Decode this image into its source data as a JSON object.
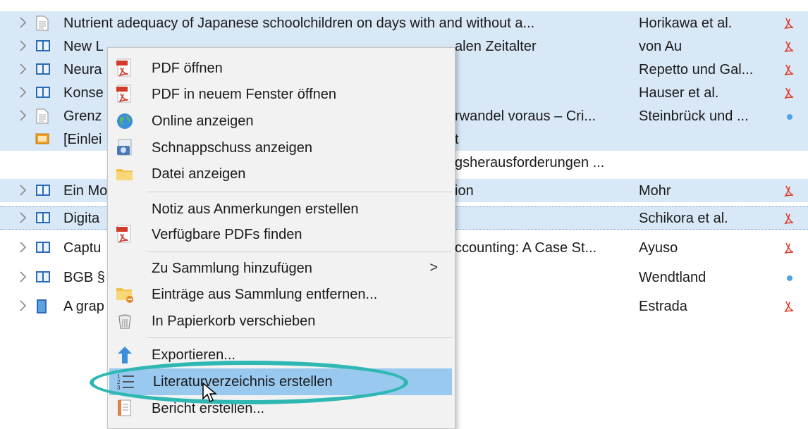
{
  "items": [
    {
      "title": "Nutrient adequacy of Japanese schoolchildren on days with and without a...",
      "creator": "Horikawa et al.",
      "type_icon": "document-icon",
      "attachment": "pdf-icon",
      "selected": true,
      "twisty": true
    },
    {
      "title": "New L",
      "title_tail": "alen Zeitalter",
      "creator": "von Au",
      "type_icon": "book-icon",
      "attachment": "pdf-icon",
      "selected": true,
      "twisty": true
    },
    {
      "title": "Neura",
      "title_tail": "",
      "creator": "Repetto und Gal...",
      "type_icon": "book-icon",
      "attachment": "pdf-icon",
      "selected": true,
      "twisty": true
    },
    {
      "title": "Konse",
      "title_tail": "rwandel voraus – Cri...",
      "creator": "Hauser et al.",
      "type_icon": "book-icon",
      "attachment": "pdf-icon",
      "selected": true,
      "twisty": true
    },
    {
      "title": "Grenz",
      "title_tail": "t",
      "creator": "Steinbrück und ...",
      "type_icon": "document-icon",
      "attachment": "dot-icon",
      "selected": true,
      "twisty": true
    },
    {
      "title": "[Einlei",
      "title_tail": "gsherausforderungen ...",
      "creator": "",
      "type_icon": "presentation-icon",
      "attachment": "",
      "selected": true,
      "twisty": false
    },
    {
      "title": "Ein Mo",
      "title_tail": "ion",
      "creator": "Mohr",
      "type_icon": "book-icon",
      "attachment": "pdf-icon",
      "selected": true,
      "twisty": true
    },
    {
      "title": "Digita",
      "title_tail": "",
      "creator": "Schikora et al.",
      "type_icon": "book-icon",
      "attachment": "pdf-icon",
      "selected": true,
      "twisty": true,
      "focus": true
    },
    {
      "title": "Captu",
      "title_tail": "ccounting: A Case St...",
      "creator": "Ayuso",
      "type_icon": "book-icon",
      "attachment": "pdf-icon",
      "selected": false,
      "twisty": true
    },
    {
      "title": "BGB §",
      "title_tail": "",
      "creator": "Wendtland",
      "type_icon": "book-icon",
      "attachment": "dot-icon",
      "selected": false,
      "twisty": true
    },
    {
      "title": "A grap",
      "title_tail": "",
      "creator": "Estrada",
      "type_icon": "journal-icon",
      "attachment": "pdf-icon",
      "selected": false,
      "twisty": true
    }
  ],
  "menu": {
    "pdf_open": "PDF öffnen",
    "pdf_new_window": "PDF in neuem Fenster öffnen",
    "online": "Online anzeigen",
    "snapshot": "Schnappschuss anzeigen",
    "file": "Datei anzeigen",
    "note_from_annotations": "Notiz aus Anmerkungen erstellen",
    "find_pdfs": "Verfügbare PDFs finden",
    "add_collection": "Zu Sammlung hinzufügen",
    "add_collection_arrow": ">",
    "remove_collection": "Einträge aus Sammlung entfernen...",
    "trash": "In Papierkorb verschieben",
    "export": "Exportieren...",
    "bibliography": "Literaturverzeichnis erstellen",
    "report": "Bericht erstellen..."
  },
  "colors": {
    "selection": "#d8e8f7",
    "menu_highlight": "#99c9ef",
    "annotation_ring": "#2fb8b3"
  }
}
